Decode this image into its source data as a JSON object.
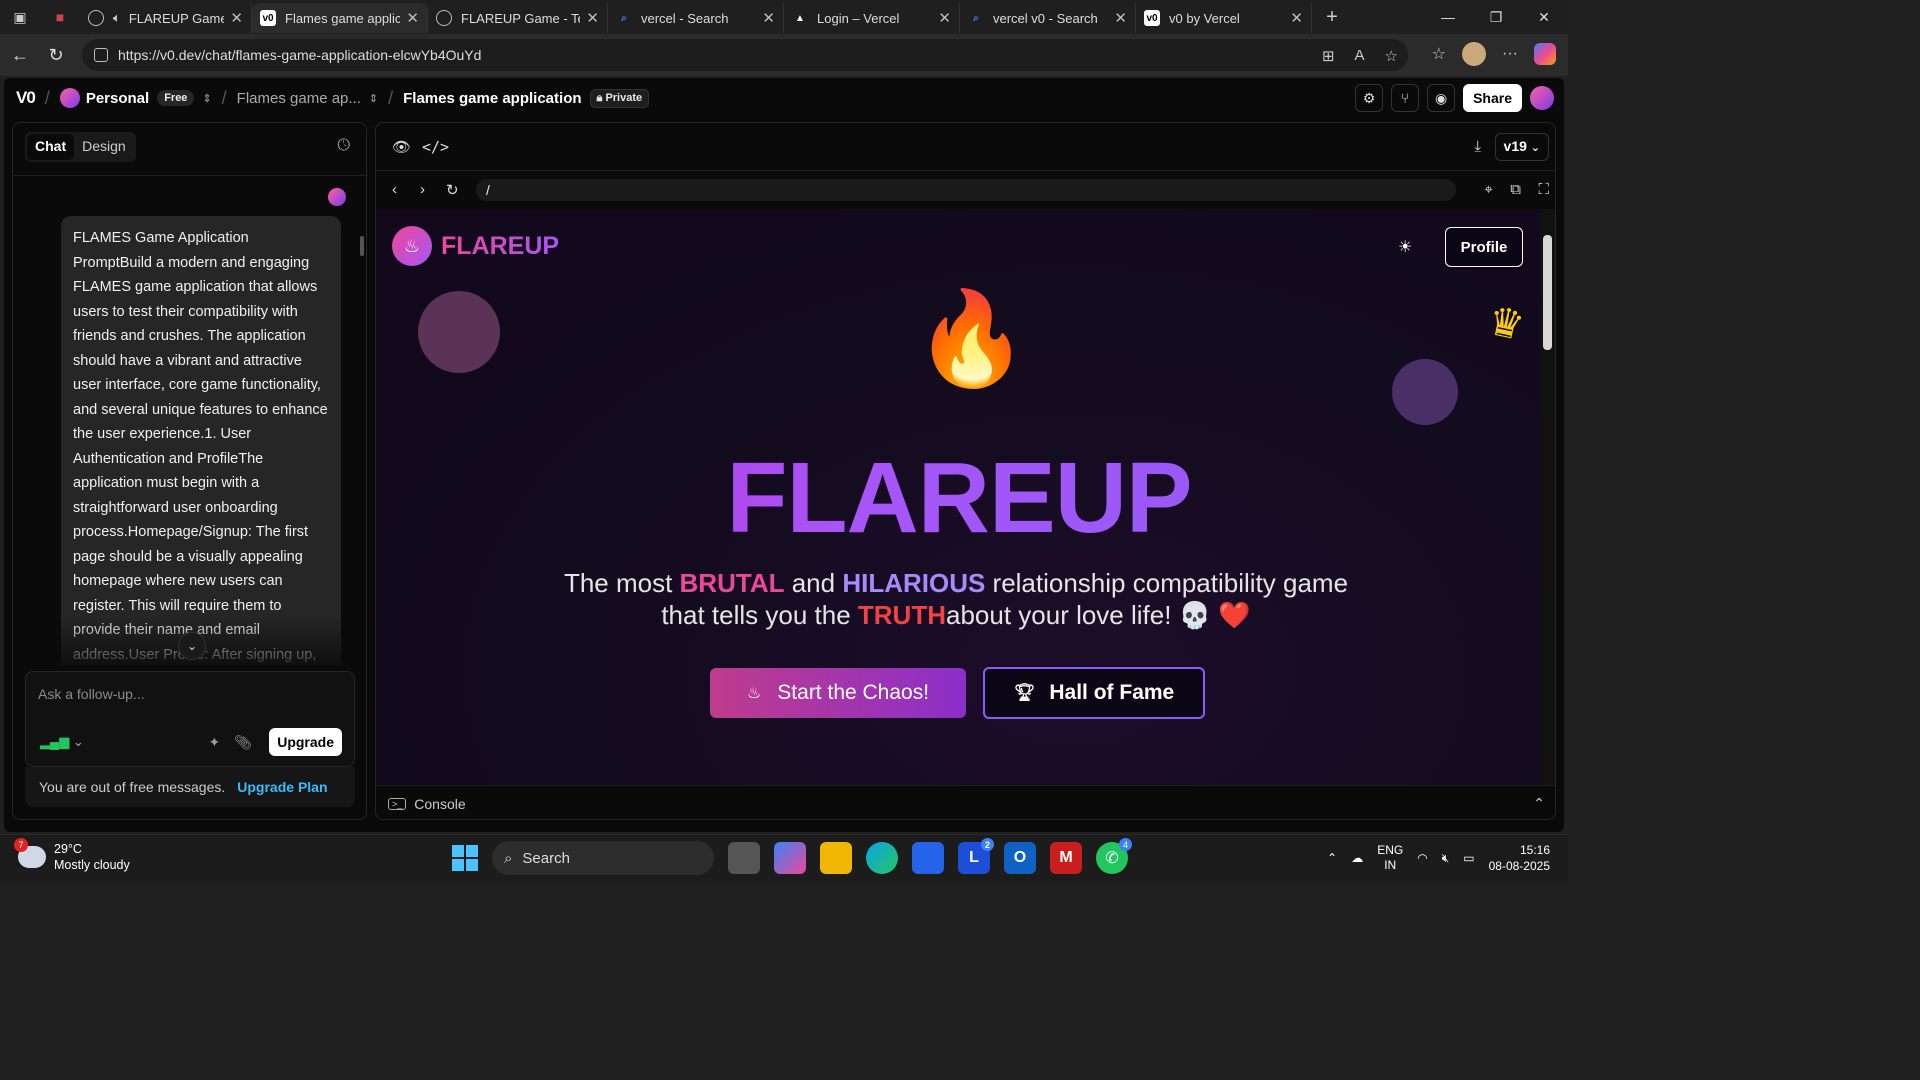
{
  "browser": {
    "tabs": [
      {
        "title": "FLAREUP Game",
        "fav": "edge-icon",
        "fav_color": "#cc3b3b",
        "active": false
      },
      {
        "title": "Flames game applicat",
        "fav": "v0",
        "fav_color": "#ffffff",
        "active": true
      },
      {
        "title": "FLAREUP Game - Test",
        "fav": "globe",
        "fav_color": "#888888",
        "active": false
      },
      {
        "title": "vercel - Search",
        "fav": "search",
        "fav_color": "#3b82f6",
        "active": false
      },
      {
        "title": "Login – Vercel",
        "fav": "triangle",
        "fav_color": "#ffffff",
        "active": false
      },
      {
        "title": "vercel v0 - Search",
        "fav": "search",
        "fav_color": "#3b82f6",
        "active": false
      },
      {
        "title": "v0 by Vercel",
        "fav": "v0",
        "fav_color": "#ffffff",
        "active": false
      }
    ],
    "url": "https://v0.dev/chat/flames-game-application-elcwYb4OuYd"
  },
  "app": {
    "logo": "V0",
    "workspace": "Personal",
    "plan_badge": "Free",
    "project_short": "Flames game ap...",
    "chat_title": "Flames game application",
    "private_badge": "Private",
    "share_label": "Share",
    "tabs": {
      "chat": "Chat",
      "design": "Design"
    },
    "message": "FLAMES Game Application PromptBuild a modern and engaging FLAMES game application that allows users to test their compatibility with friends and crushes. The application should have a vibrant and attractive user interface, core game functionality, and several unique features to enhance the user experience.1. User Authentication and ProfileThe application must begin with a straightforward user onboarding process.Homepage/Signup: The first page should be a visually appealing homepage where new users can register. This will require them to provide their name and email address.User Profile: After signing up,",
    "input_placeholder": "Ask a follow-up...",
    "upgrade_label": "Upgrade",
    "out_msg": "You are out of free messages.",
    "upgrade_plan": "Upgrade Plan",
    "version": "v19",
    "path": "/",
    "console_label": "Console"
  },
  "preview": {
    "brand": "FLAREUP",
    "profile_label": "Profile",
    "hero_title": "FLAREUP",
    "tag_1": "The most ",
    "tag_brutal": "BRUTAL",
    "tag_2": " and ",
    "tag_hilarious": "HILARIOUS",
    "tag_3": " relationship compatibility game",
    "tag_4": "that tells you the ",
    "tag_truth": "TRUTH",
    "tag_5": "about your love life! 💀 ❤️",
    "cta_primary": "Start the Chaos!",
    "cta_secondary": "Hall of Fame",
    "colors": {
      "pink": "#ec4899",
      "violet": "#a855f7",
      "red": "#ef4444"
    }
  },
  "taskbar": {
    "weather_temp": "29°C",
    "weather_desc": "Mostly cloudy",
    "weather_badge": "7",
    "search_label": "Search",
    "lang_1": "ENG",
    "lang_2": "IN",
    "time": "15:16",
    "date": "08-08-2025",
    "badge_l": "2",
    "badge_wa": "4"
  }
}
